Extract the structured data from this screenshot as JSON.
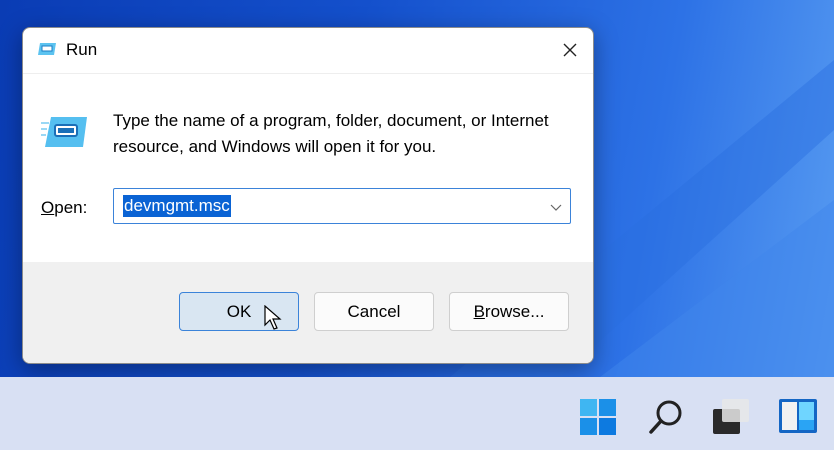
{
  "dialog": {
    "title": "Run",
    "description": "Type the name of a program, folder, document, or Internet resource, and Windows will open it for you.",
    "open_label_accel": "O",
    "open_label_rest": "pen:",
    "open_value": "devmgmt.msc",
    "buttons": {
      "ok": "OK",
      "cancel": "Cancel",
      "browse_accel": "B",
      "browse_rest": "rowse..."
    }
  },
  "taskbar": {
    "icons": [
      "start-icon",
      "search-icon",
      "task-view-icon",
      "widgets-icon"
    ]
  },
  "colors": {
    "accent": "#0a63d4",
    "taskbar": "#d8e0f3",
    "footer": "#f0f0f0"
  }
}
